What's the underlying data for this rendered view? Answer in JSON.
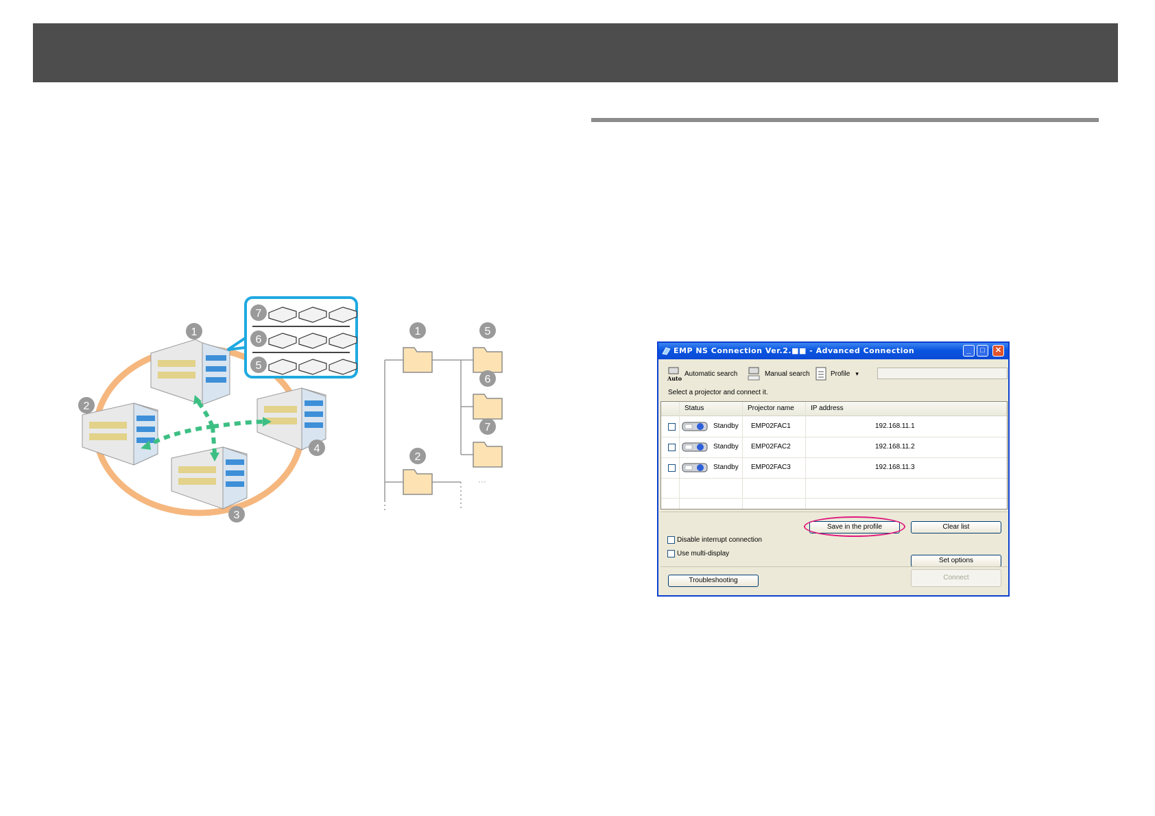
{
  "diagram": {
    "callouts": [
      "1",
      "2",
      "3",
      "4",
      "5",
      "6",
      "7"
    ],
    "tree_callouts": [
      "1",
      "5",
      "6",
      "7",
      "2"
    ],
    "tree_more": "···"
  },
  "dialog": {
    "title": "EMP NS Connection Ver.2.■■ - Advanced Connection",
    "toolbar": {
      "auto_icon_label": "Auto",
      "automatic_search": "Automatic search",
      "manual_search": "Manual search",
      "profile": "Profile",
      "profile_arrow": "▾",
      "profile_value": ""
    },
    "instruction": "Select a projector and connect it.",
    "columns": [
      "Status",
      "Projector name",
      "IP address"
    ],
    "rows": [
      {
        "status": "Standby",
        "name": "EMP02FAC1",
        "ip": "192.168.11.1"
      },
      {
        "status": "Standby",
        "name": "EMP02FAC2",
        "ip": "192.168.11.2"
      },
      {
        "status": "Standby",
        "name": "EMP02FAC3",
        "ip": "192.168.11.3"
      }
    ],
    "buttons": {
      "save_profile": "Save in the profile",
      "clear_list": "Clear list",
      "set_options": "Set options",
      "troubleshooting": "Troubleshooting",
      "connect": "Connect"
    },
    "options": {
      "disable_interrupt": "Disable interrupt connection",
      "multi_display": "Use multi-display"
    },
    "window_buttons": {
      "minimize": "_",
      "maximize": "□",
      "close": "✕"
    }
  },
  "colors": {
    "header_bar": "#4d4d4d",
    "callout_border": "#1fa9e0",
    "ring": "#f5b77e",
    "arrows": "#3dbf84",
    "folder": "#fde3b3",
    "highlight_ellipse": "#e0197d"
  }
}
